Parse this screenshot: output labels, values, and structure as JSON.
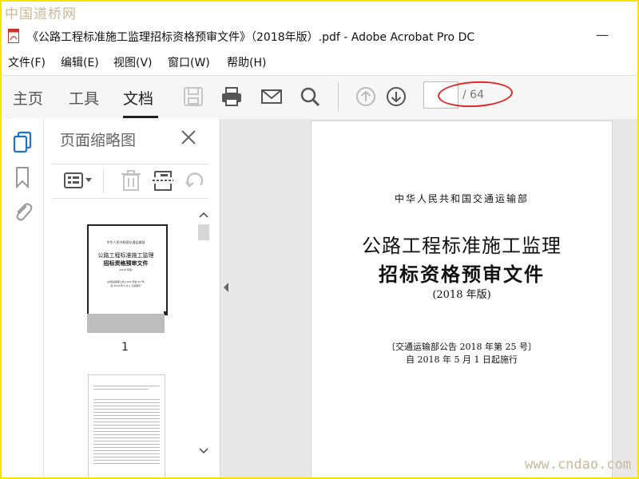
{
  "watermark": {
    "top": "中国道桥网",
    "bottom": "www.cndao.com"
  },
  "window": {
    "title": "《公路工程标准施工监理招标资格预审文件》（2018年版）.pdf - Adobe Acrobat Pro DC",
    "minimize_glyph": "—"
  },
  "menu": {
    "items": [
      {
        "label": "文件(F)"
      },
      {
        "label": "编辑(E)"
      },
      {
        "label": "视图(V)"
      },
      {
        "label": "窗口(W)"
      },
      {
        "label": "帮助(H)"
      }
    ]
  },
  "toolbar": {
    "tabs": [
      {
        "label": "主页",
        "active": false
      },
      {
        "label": "工具",
        "active": false
      },
      {
        "label": "文档",
        "active": true
      }
    ],
    "icons": [
      "save-icon",
      "print-icon",
      "mail-icon",
      "search-icon",
      "prev-page-icon",
      "next-page-icon"
    ],
    "page_input_value": "",
    "page_total": "/ 64"
  },
  "left_rail": {
    "icons": [
      "page-thumbnails-icon",
      "bookmark-icon",
      "attachment-icon"
    ]
  },
  "thumbnail_panel": {
    "title": "页面缩略图",
    "tools": [
      "options-icon",
      "delete-icon",
      "extract-icon",
      "rotate-icon"
    ],
    "thumbnails": [
      {
        "label": "1",
        "org": "中华人民共和国交通运输部",
        "title1": "公路工程标准施工监理",
        "title2": "招标资格预审文件",
        "edition": "(2018 年版)",
        "notice": "(交通运输部公告 2018 年第 25 号)",
        "effective": "自 2018 年 5 月 1 日起施行"
      },
      {
        "label": ""
      }
    ]
  },
  "document": {
    "org": "中华人民共和国交通运输部",
    "title_line1": "公路工程标准施工监理",
    "title_line2": "招标资格预审文件",
    "edition": "(2018 年版)",
    "notice": "〔交通运输部公告 2018 年第 25 号〕",
    "effective": "自 2018 年 5 月 1 日起施行"
  },
  "colors": {
    "annotation_ellipse": "#e02a2a",
    "frame_border": "#f5e400",
    "toolbar_bg": "#f6f6f6"
  }
}
